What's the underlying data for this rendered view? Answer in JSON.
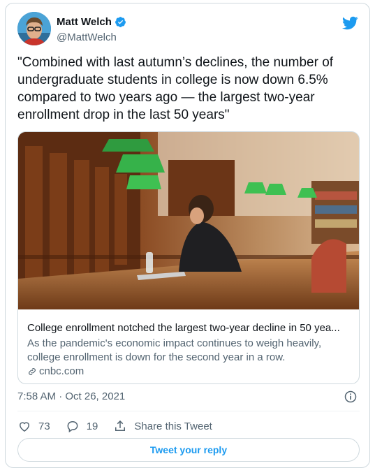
{
  "author": {
    "name": "Matt Welch",
    "handle": "@MattWelch"
  },
  "tweet": {
    "text": "\"Combined with last autumn’s declines, the number of undergraduate students in college is now down 6.5% compared to two years ago — the largest two-year enrollment drop in the last 50 years\""
  },
  "link_card": {
    "title": "College enrollment notched the largest two-year decline in 50 yea...",
    "description": "As the pandemic's economic impact continues to weigh heavily, college enrollment is down for the second year in a row.",
    "domain": "cnbc.com"
  },
  "meta": {
    "timestamp": "7:58 AM · Oct 26, 2021"
  },
  "actions": {
    "likes": "73",
    "replies": "19",
    "share_label": "Share this Tweet",
    "reply_button": "Tweet your reply"
  },
  "colors": {
    "accent": "#1d9bf0",
    "secondary_text": "#536471",
    "border": "#cfd9de"
  },
  "icons": [
    "verified-icon",
    "twitter-bird-icon",
    "link-icon",
    "info-icon",
    "heart-icon",
    "comment-icon",
    "share-icon"
  ]
}
